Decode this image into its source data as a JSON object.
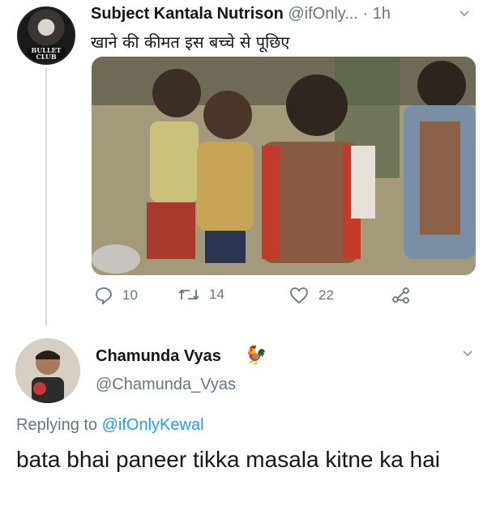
{
  "tweet": {
    "display_name": "Subject Kantala Nutrison",
    "handle": "@ifOnly...",
    "time": "· 1h",
    "text": "खाने की कीमत इस बच्चे से पूछिए",
    "avatar_badge_line1": "BULLET",
    "avatar_badge_line2": "CLUB",
    "actions": {
      "reply_count": "10",
      "retweet_count": "14",
      "like_count": "22"
    },
    "icons": [
      "reply-icon",
      "retweet-icon",
      "like-icon",
      "share-icon",
      "chevron-down-icon"
    ]
  },
  "reply": {
    "display_name": "Chamunda Vyas",
    "name_emoji": "🐓",
    "handle": "@Chamunda_Vyas",
    "replying_label": "Replying to",
    "replying_handle": "@ifOnlyKewal",
    "text": "bata bhai paneer tikka masala kitne ka hai"
  },
  "colors": {
    "link": "#1da1f2",
    "muted": "#657786",
    "text": "#14171a"
  }
}
